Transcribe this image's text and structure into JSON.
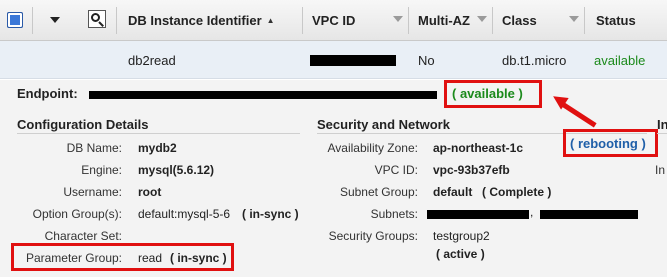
{
  "table": {
    "columns": {
      "db_instance_identifier": "DB Instance Identifier",
      "vpc_id": "VPC ID",
      "multi_az": "Multi-AZ",
      "class": "Class",
      "status": "Status"
    },
    "row": {
      "identifier": "db2read",
      "multi_az": "No",
      "class": "db.t1.micro",
      "status": "available"
    }
  },
  "endpoint": {
    "label": "Endpoint:",
    "status": "( available )"
  },
  "configuration": {
    "title": "Configuration Details",
    "db_name_label": "DB Name:",
    "db_name": "mydb2",
    "engine_label": "Engine:",
    "engine": "mysql(5.6.12)",
    "username_label": "Username:",
    "username": "root",
    "option_group_label": "Option Group(s):",
    "option_group": "default:mysql-5-6",
    "option_group_status": "( in-sync )",
    "character_set_label": "Character Set:",
    "parameter_group_label": "Parameter Group:",
    "parameter_group": "read",
    "parameter_group_status": "( in-sync )"
  },
  "security": {
    "title": "Security and Network",
    "az_label": "Availability Zone:",
    "az": "ap-northeast-1c",
    "az_status": "( rebooting )",
    "vpc_id_label": "VPC ID:",
    "vpc_id": "vpc-93b37efb",
    "subnet_group_label": "Subnet Group:",
    "subnet_group": "default",
    "subnet_group_status": "( Complete )",
    "subnets_label": "Subnets:",
    "security_groups_label": "Security Groups:",
    "security_group": "testgroup2",
    "security_group_status": "( active )"
  },
  "third_section": {
    "title_partial": "In",
    "label_partial": "In"
  },
  "colors": {
    "status_green": "#1c8a1c",
    "link_blue": "#1f5fa8",
    "highlight_red": "#e01010",
    "selected_row": "#e9eff6"
  }
}
